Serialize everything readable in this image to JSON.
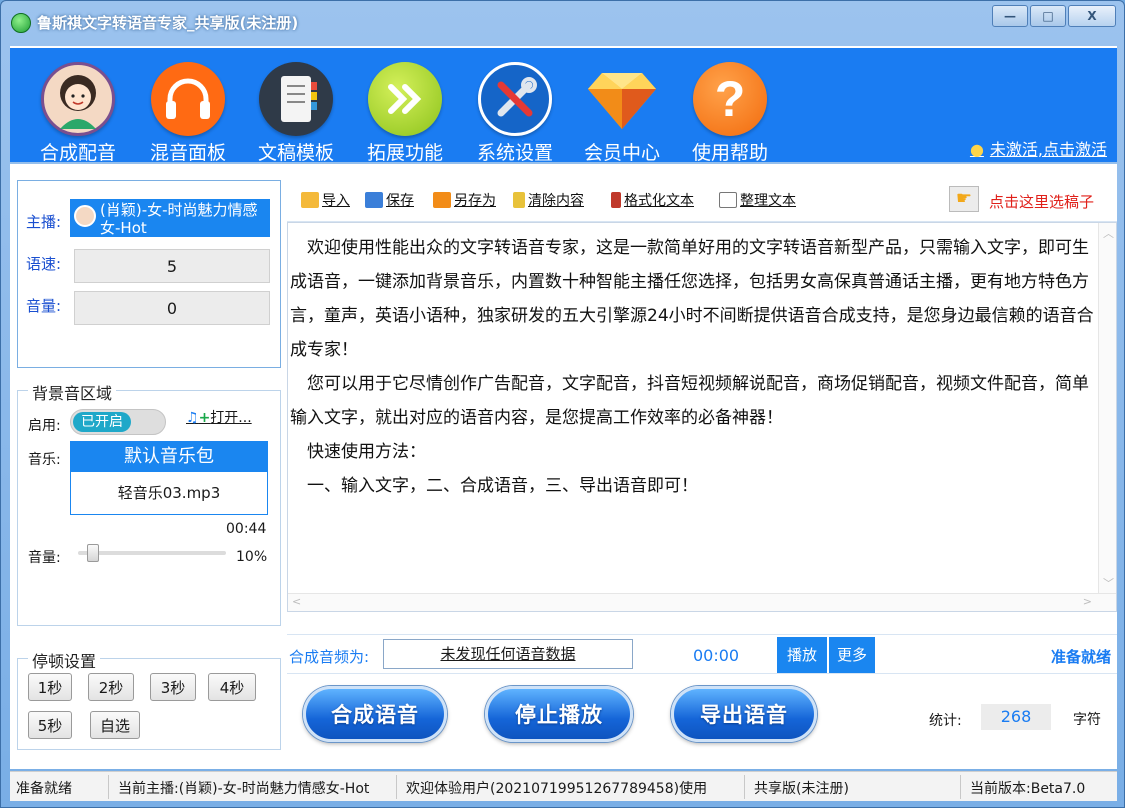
{
  "window": {
    "title": "鲁斯祺文字转语音专家_共享版(未注册)",
    "controls": [
      "▭",
      "□",
      "X"
    ]
  },
  "toolbar": {
    "items": [
      {
        "label": "合成配音",
        "icon": "female-avatar-icon"
      },
      {
        "label": "混音面板",
        "icon": "headphones-icon"
      },
      {
        "label": "文稿模板",
        "icon": "notebook-icon"
      },
      {
        "label": "拓展功能",
        "icon": "double-arrow-icon"
      },
      {
        "label": "系统设置",
        "icon": "tools-icon"
      },
      {
        "label": "会员中心",
        "icon": "diamond-icon"
      },
      {
        "label": "使用帮助",
        "icon": "question-icon"
      }
    ],
    "activate_link": "未激活,点击激活"
  },
  "voice_panel": {
    "anchor_label": "主播:",
    "anchor_value": "(肖颖)-女-时尚魅力情感女-Hot",
    "speed_label": "语速:",
    "speed_value": "5",
    "volume_label": "音量:",
    "volume_value": "0"
  },
  "bg_music": {
    "group_title": "背景音区域",
    "enable_label": "启用:",
    "toggle_text": "已开启",
    "open_button": "打开...",
    "music_label": "音乐:",
    "pack_name": "默认音乐包",
    "file_name": "轻音乐03.mp3",
    "duration": "00:44",
    "volume_label": "音量:",
    "volume_percent": "10%",
    "volume_fraction": 0.1
  },
  "pause_settings": {
    "group_title": "停顿设置",
    "buttons": [
      "1秒",
      "2秒",
      "3秒",
      "4秒",
      "5秒",
      "自选"
    ]
  },
  "text_toolbar": {
    "import": "导入",
    "save": "保存",
    "save_as": "另存为",
    "clear": "清除内容",
    "format": "格式化文本",
    "organize": "整理文本",
    "select_script": "点击这里选稿子"
  },
  "editor": {
    "paragraphs": [
      "欢迎使用性能出众的文字转语音专家，这是一款简单好用的文字转语音新型产品，只需输入文字，即可生成语音，一键添加背景音乐，内置数十种智能主播任您选择，包括男女高保真普通话主播，更有地方特色方言，童声，英语小语种，独家研发的五大引擎源24小时不间断提供语音合成支持，是您身边最信赖的语音合成专家！",
      "您可以用于它尽情创作广告配音，文字配音，抖音短视频解说配音，商场促销配音，视频文件配音，简单输入文字，就出对应的语音内容，是您提高工作效率的必备神器！",
      "快速使用方法：",
      "一、输入文字，二、合成语音，三、导出语音即可！"
    ]
  },
  "audio_bar": {
    "label": "合成音频为:",
    "status_field": "未发现任何语音数据",
    "time": "00:00",
    "play": "播放",
    "more": "更多",
    "ready": "准备就绪"
  },
  "actions": {
    "synthesize": "合成语音",
    "stop": "停止播放",
    "export": "导出语音",
    "stats_label": "统计:",
    "char_count": "268",
    "char_unit": "字符"
  },
  "statusbar": {
    "status": "准备就绪",
    "current_anchor": "当前主播:(肖颖)-女-时尚魅力情感女-Hot",
    "welcome": "欢迎体验用户(20210719951267789458)使用",
    "edition": "共享版(未注册)",
    "version": "当前版本:Beta7.0"
  },
  "colors": {
    "toolbar_blue": "#1a7cf2",
    "label_blue": "#1a4fd0",
    "accent_red": "#e0201a"
  }
}
